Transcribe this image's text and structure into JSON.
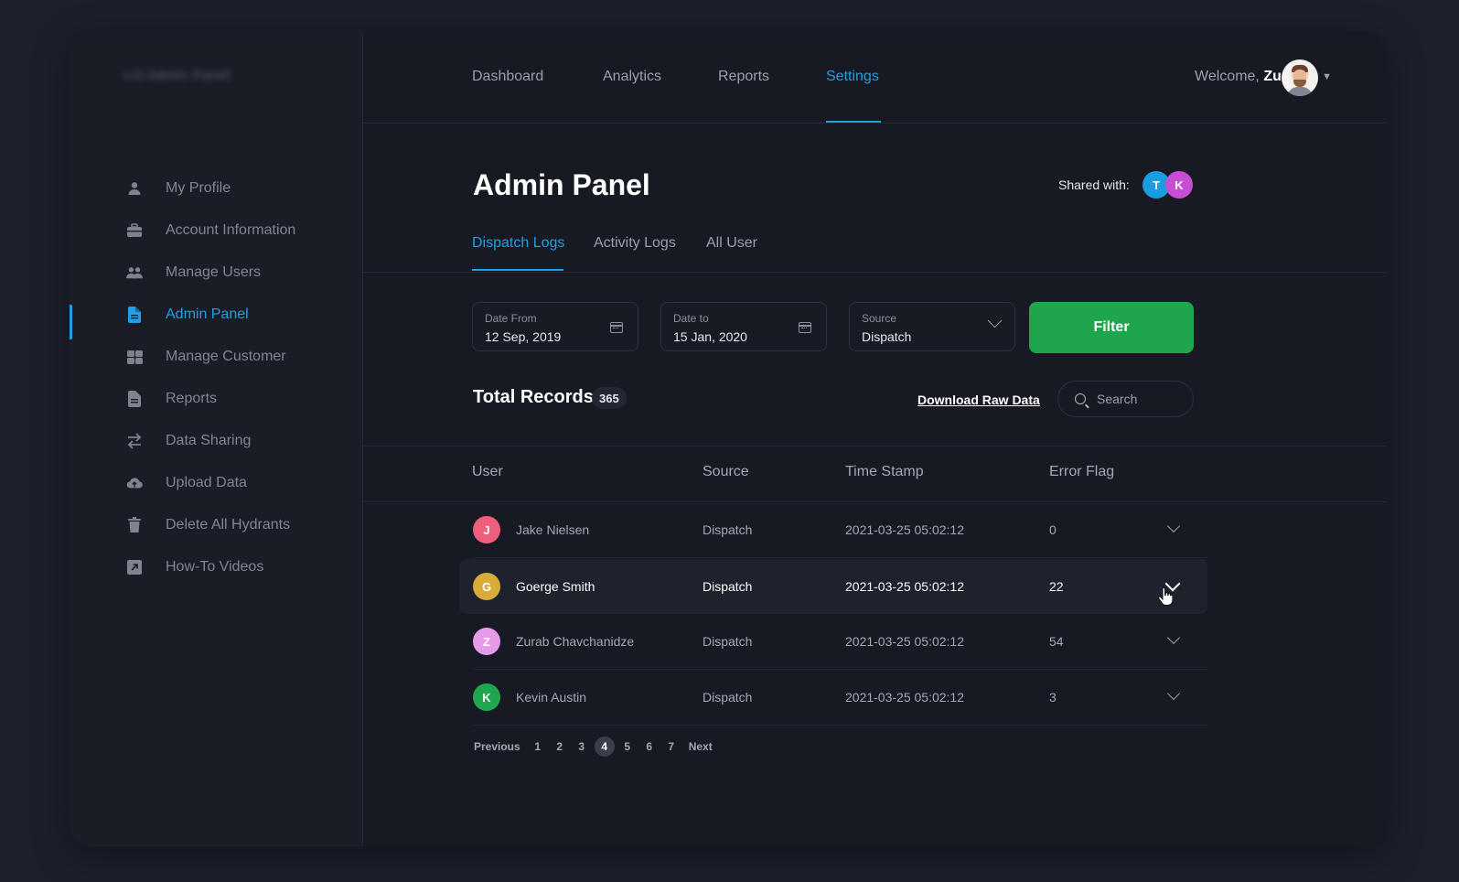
{
  "app": {
    "logo_text": "LO Admin Panel"
  },
  "sidebar": {
    "items": [
      {
        "label": "My Profile",
        "icon": "user-icon"
      },
      {
        "label": "Account Information",
        "icon": "briefcase-icon"
      },
      {
        "label": "Manage Users",
        "icon": "users-icon"
      },
      {
        "label": "Admin Panel",
        "icon": "document-icon",
        "active": true
      },
      {
        "label": "Manage Customer",
        "icon": "grid-icon"
      },
      {
        "label": "Reports",
        "icon": "file-icon"
      },
      {
        "label": "Data Sharing",
        "icon": "swap-arrows-icon"
      },
      {
        "label": "Upload Data",
        "icon": "cloud-upload-icon"
      },
      {
        "label": "Delete All Hydrants",
        "icon": "trash-icon"
      },
      {
        "label": "How-To Videos",
        "icon": "external-video-icon"
      }
    ]
  },
  "topnav": {
    "items": [
      "Dashboard",
      "Analytics",
      "Reports",
      "Settings"
    ],
    "active": "Settings",
    "welcome_prefix": "Welcome,",
    "user_name": "Zura"
  },
  "page": {
    "title": "Admin Panel",
    "shared_label": "Shared with:",
    "shared_avatars": [
      {
        "initial": "T",
        "color": "#1a9ce0"
      },
      {
        "initial": "K",
        "color": "#c74ed4"
      }
    ]
  },
  "tabs": [
    "Dispatch Logs",
    "Activity Logs",
    "All User"
  ],
  "filters": {
    "date_from": {
      "label": "Date From",
      "value": "12 Sep, 2019"
    },
    "date_to": {
      "label": "Date to",
      "value": "15 Jan, 2020"
    },
    "source": {
      "label": "Source",
      "value": "Dispatch"
    },
    "filter_button": "Filter"
  },
  "records": {
    "title": "Total Records",
    "count": "365",
    "download_label": "Download Raw Data",
    "search_placeholder": "Search"
  },
  "table": {
    "headers": [
      "User",
      "Source",
      "Time Stamp",
      "Error Flag"
    ],
    "rows": [
      {
        "initial": "J",
        "color": "#ee5f7d",
        "name": "Jake Nielsen",
        "source": "Dispatch",
        "timestamp": "2021-03-25 05:02:12",
        "error_flag": "0"
      },
      {
        "initial": "G",
        "color": "#d8ac38",
        "name": "Goerge Smith",
        "source": "Dispatch",
        "timestamp": "2021-03-25 05:02:12",
        "error_flag": "22"
      },
      {
        "initial": "Z",
        "color": "#e59be8",
        "name": "Zurab Chavchanidze",
        "source": "Dispatch",
        "timestamp": "2021-03-25 05:02:12",
        "error_flag": "54"
      },
      {
        "initial": "K",
        "color": "#20a651",
        "name": "Kevin Austin",
        "source": "Dispatch",
        "timestamp": "2021-03-25 05:02:12",
        "error_flag": "3"
      }
    ]
  },
  "pagination": {
    "previous": "Previous",
    "pages": [
      "1",
      "2",
      "3",
      "4",
      "5",
      "6",
      "7"
    ],
    "current": "4",
    "next": "Next"
  },
  "colors": {
    "accent": "#1fa0e5",
    "filter_button": "#1ea54d"
  }
}
